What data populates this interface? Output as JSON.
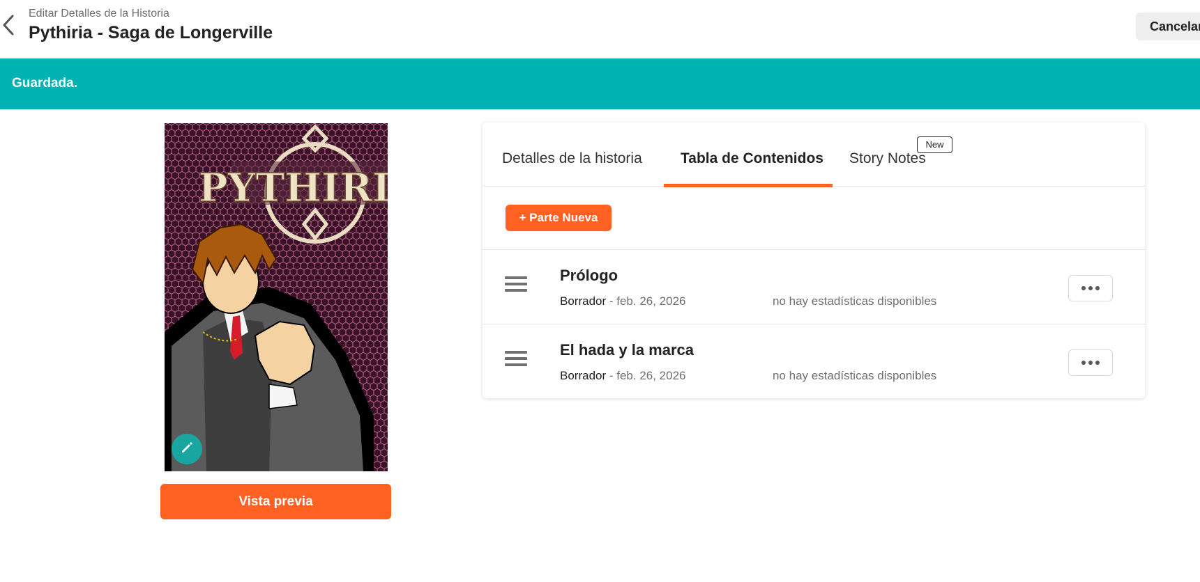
{
  "header": {
    "subtitle": "Editar Detalles de la Historia",
    "title": "Pythiria - Saga de Longerville",
    "cancel_label": "Cancelar",
    "back_icon": "chevron-left-icon"
  },
  "banner": {
    "text": "Guardada.",
    "color": "#00b2b2"
  },
  "cover": {
    "logo_text": "PYTHIRIA",
    "edit_icon": "pencil-icon",
    "preview_label": "Vista previa"
  },
  "tabs": [
    {
      "label": "Detalles de la historia",
      "active": false
    },
    {
      "label": "Tabla de Contenidos",
      "active": true
    },
    {
      "label": "Story Notes",
      "active": false,
      "badge": "New"
    }
  ],
  "toc": {
    "new_part_label": "+ Parte Nueva",
    "parts": [
      {
        "title": "Prólogo",
        "status": "Borrador",
        "separator": " - ",
        "date": "feb. 26, 2026",
        "stats": "no hay estadísticas disponibles"
      },
      {
        "title": "El hada y la marca",
        "status": "Borrador",
        "separator": " - ",
        "date": "feb. 26, 2026",
        "stats": "no hay estadísticas disponibles"
      }
    ]
  },
  "colors": {
    "accent": "#ff6122",
    "teal": "#00b2b2"
  }
}
